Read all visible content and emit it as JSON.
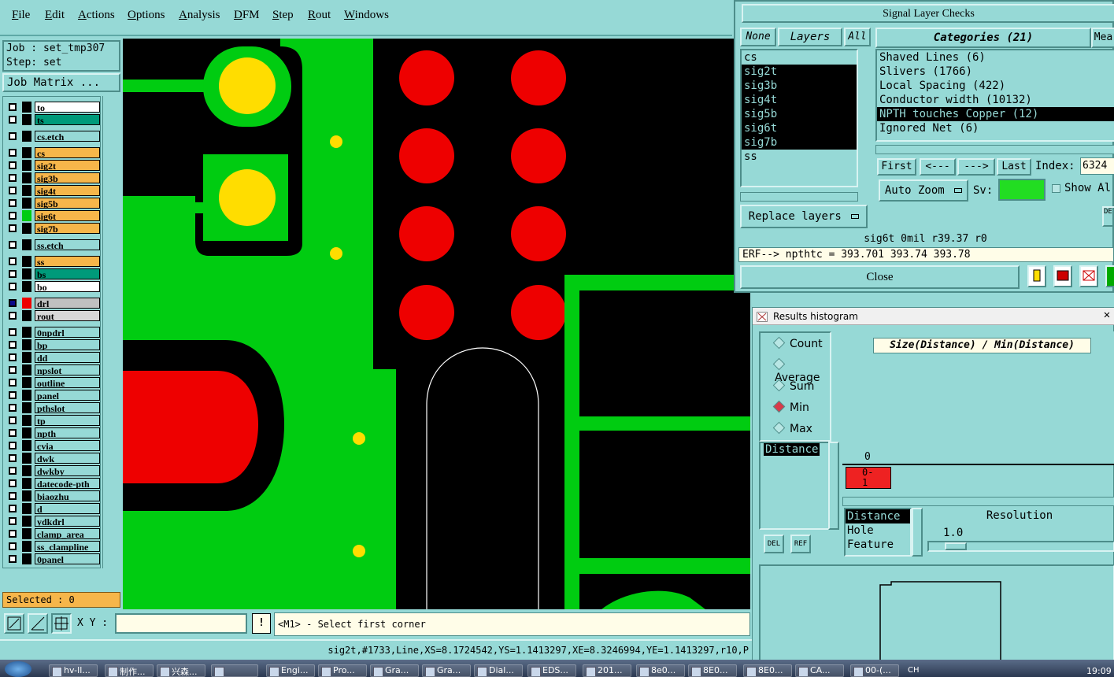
{
  "menu": [
    "File",
    "Edit",
    "Actions",
    "Options",
    "Analysis",
    "DFM",
    "Step",
    "Rout",
    "Windows"
  ],
  "job": {
    "job_line": "Job : set_tmp307",
    "step_line": "Step: set",
    "matrix_button": "Job Matrix ..."
  },
  "layers": [
    {
      "name": "to",
      "color": "#ffffff"
    },
    {
      "name": "ts",
      "color": "#009a7a"
    },
    {
      "name": "cs.etch",
      "color": "#96d9d6"
    },
    {
      "name": "cs",
      "color": "#f6b64a"
    },
    {
      "name": "sig2t",
      "color": "#f6b64a"
    },
    {
      "name": "sig3b",
      "color": "#f6b64a"
    },
    {
      "name": "sig4t",
      "color": "#f6b64a"
    },
    {
      "name": "sig5b",
      "color": "#f6b64a"
    },
    {
      "name": "sig6t",
      "color": "#f6b64a"
    },
    {
      "name": "sig7b",
      "color": "#f6b64a"
    },
    {
      "name": "ss.etch",
      "color": "#96d9d6"
    },
    {
      "name": "ss",
      "color": "#f6b64a"
    },
    {
      "name": "bs",
      "color": "#009a7a"
    },
    {
      "name": "bo",
      "color": "#ffffff"
    },
    {
      "name": "drl",
      "color": "#c0c0c0"
    },
    {
      "name": "rout",
      "color": "#d8d8d8"
    },
    {
      "name": "0npdrl",
      "color": "#96d9d6"
    },
    {
      "name": "bp",
      "color": "#96d9d6"
    },
    {
      "name": "dd",
      "color": "#96d9d6"
    },
    {
      "name": "npslot",
      "color": "#96d9d6"
    },
    {
      "name": "outline",
      "color": "#96d9d6"
    },
    {
      "name": "panel",
      "color": "#96d9d6"
    },
    {
      "name": "pthslot",
      "color": "#96d9d6"
    },
    {
      "name": "tp",
      "color": "#96d9d6"
    },
    {
      "name": "npth",
      "color": "#96d9d6"
    },
    {
      "name": "cvia",
      "color": "#96d9d6"
    },
    {
      "name": "dwk",
      "color": "#96d9d6"
    },
    {
      "name": "dwkby",
      "color": "#96d9d6"
    },
    {
      "name": "datecode-pth",
      "color": "#96d9d6"
    },
    {
      "name": "biaozhu",
      "color": "#96d9d6"
    },
    {
      "name": "d",
      "color": "#96d9d6"
    },
    {
      "name": "ydkdrl",
      "color": "#96d9d6"
    },
    {
      "name": "clamp_area",
      "color": "#96d9d6"
    },
    {
      "name": "ss_clampline",
      "color": "#96d9d6"
    },
    {
      "name": "0panel",
      "color": "#96d9d6"
    }
  ],
  "selected_text": "Selected : 0",
  "xy": {
    "label": "X Y :",
    "value": "",
    "warn": "!",
    "prompt": "<M1> - Select first corner"
  },
  "status_line": "sig2t,#1733,Line,XS=8.1724542,YS=1.1413297,XE=8.3246994,YE=1.1413297,r10,P",
  "signal_checks": {
    "title": "Signal Layer Checks",
    "none_btn": "None",
    "layers_btn": "Layers",
    "all_btn": "All",
    "categories_btn": "Categories (21)",
    "meas_btn": "Mea",
    "layer_list": [
      "cs",
      "sig2t",
      "sig3b",
      "sig4t",
      "sig5b",
      "sig6t",
      "sig7b",
      "ss"
    ],
    "category_list": [
      "Shaved Lines (6)",
      "Slivers (1766)",
      "Local Spacing (422)",
      "Conductor width (10132)",
      "NPTH touches Copper (12)",
      "Ignored Net (6)"
    ],
    "first": "First",
    "prev": "<---",
    "next": "--->",
    "last": "Last",
    "index_label": "Index:",
    "index_value": "6324",
    "auto_zoom": "Auto Zoom",
    "sv_label": "Sv:",
    "show_label": "Show Al",
    "replace_layers": "Replace layers",
    "info": "sig6t  0mil  r39.37  r0",
    "erf": "ERF--> npthtc = 393.701 393.74 393.78",
    "close": "Close",
    "del_label": "DE"
  },
  "histogram": {
    "title": "Results histogram",
    "options": [
      "Count",
      "Average",
      "Sum",
      "Min",
      "Max"
    ],
    "selected_option": "Min",
    "heading": "Size(Distance) / Min(Distance)",
    "left_list": [
      "Distance"
    ],
    "bar_top_label": "0",
    "bar_label": "0-\n1",
    "bar_color": "#ee2222",
    "del_label": "DEL",
    "ref_label": "REF",
    "attr_list": [
      "Distance",
      "Hole",
      "Feature"
    ],
    "resolution_label": "Resolution",
    "resolution_value": "1.0"
  },
  "taskbar": [
    "hv-ll...",
    "制作...",
    "兴森...",
    "",
    "Engi...",
    "Pro...",
    "Gra...",
    "Gra...",
    "Dial...",
    "EDS...",
    "201...",
    "8e0...",
    "8E0...",
    "8E0...",
    "CA...",
    "00-(..."
  ],
  "tray": {
    "lang": "CH",
    "time": "19:09"
  },
  "colors": {
    "copper": "#00cc11",
    "pad_yellow": "#ffdd00",
    "drill_red": "#ee0000",
    "panel_bg": "#96d9d6"
  }
}
